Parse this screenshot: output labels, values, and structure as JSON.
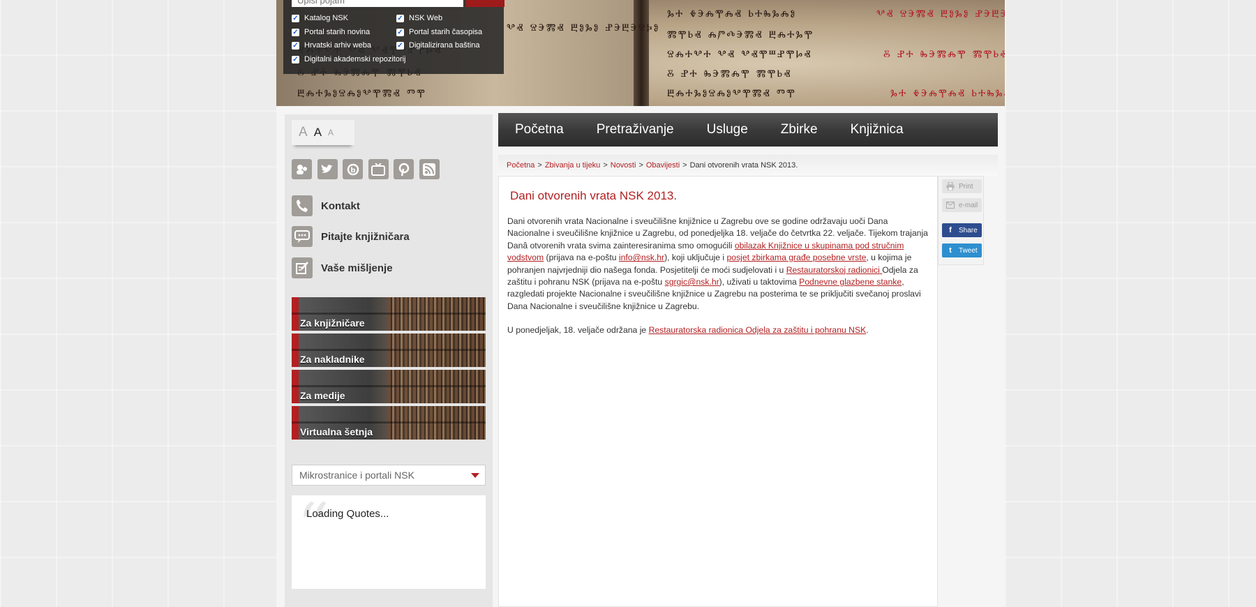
{
  "search": {
    "placeholder": "Upiši pojam",
    "sources": [
      {
        "label": "Katalog NSK",
        "checked": true
      },
      {
        "label": "NSK Web",
        "checked": true
      },
      {
        "label": "Portal starih novina",
        "checked": true
      },
      {
        "label": "Portal starih časopisa",
        "checked": true
      },
      {
        "label": "Hrvatski arhiv weba",
        "checked": true
      },
      {
        "label": "Digitalizirana baština",
        "checked": true
      },
      {
        "label": "Digitalni akademski repozitorij",
        "checked": true
      }
    ]
  },
  "font_sizer": {
    "large": "A",
    "medium": "A",
    "small": "A"
  },
  "social_icons": [
    "community-icon",
    "twitter-icon",
    "blog-icon",
    "tv-icon",
    "pinterest-icon",
    "rss-icon"
  ],
  "contact": {
    "items": [
      {
        "label": "Kontakt",
        "icon": "phone-icon"
      },
      {
        "label": "Pitajte knjižničara",
        "icon": "chat-icon"
      },
      {
        "label": "Vaše mišljenje",
        "icon": "feedback-icon"
      }
    ]
  },
  "tiles": [
    {
      "label": "Za knjižničare"
    },
    {
      "label": "Za nakladnike"
    },
    {
      "label": "Za medije"
    },
    {
      "label": "Virtualna šetnja"
    }
  ],
  "microsite_select": {
    "value": "Mikrostranice i portali NSK"
  },
  "quotes": {
    "text": "Loading Quotes..."
  },
  "nav": {
    "items": [
      "Početna",
      "Pretraživanje",
      "Usluge",
      "Zbirke",
      "Knjižnica"
    ]
  },
  "breadcrumb": {
    "links": [
      "Početna",
      "Zbivanja u tijeku",
      "Novosti",
      "Obavijesti"
    ],
    "current": "Dani otvorenih vrata NSK 2013."
  },
  "article": {
    "title": "Dani otvorenih vrata NSK 2013.",
    "p1": {
      "t1": "Dani otvorenih vrata Nacionalne i sveučilišne knjižnice u Zagrebu ove se godine održavaju uoči Dana Nacionalne i sveučilišne knjižnice u Zagrebu, od ponedjeljka 18. veljače do četvrtka 22. veljače. Tijekom trajanja Danâ otvorenih vrata svima zainteresiranima smo omogućili ",
      "l1": "obilazak Knjižnice u skupinama pod stručnim vodstvom",
      "t2": " (prijava na e-poštu ",
      "l2": "info@nsk.hr",
      "t3": "), koji uključuje i ",
      "l3": "posjet zbirkama građe posebne vrste",
      "t4": ", u kojima je pohranjen najvrjedniji dio našega fonda. Posjetitelji će moći sudjelovati i u ",
      "l4": "Restauratorskoj radionici ",
      "t5": "Odjela za zaštitu i pohranu NSK (prijava na e-poštu ",
      "l5": "sgrgic@nsk.hr",
      "t6": "), uživati u taktovima ",
      "l6": "Podnevne glazbene stanke",
      "t7": ", razgledati projekte Nacionalne i sveučilišne knjižnice u Zagrebu na posterima te se priključiti svečanoj proslavi Dana Nacionalne i sveučilišne knjižnice u Zagrebu."
    },
    "p2": {
      "t1": "U ponedjeljak, 18. veljače održana je ",
      "l1": "Restauratorska radionica Odjela za zaštitu i pohranu NSK",
      "t2": "."
    }
  },
  "tools": {
    "print": "Print",
    "email": "e-mail",
    "share": "Share",
    "tweet": "Tweet"
  },
  "banner_text": {
    "row1": "ⰳⰰ ⰷⰵⰾⰹⰾⱏ ⱃⰰⰸⰳⰾⱁ",
    "row2": "ⰲⱏ ⱄⰵⰿⱏ ⰱⱁⰳⱁ ⱀⰵⰱⰵⱄⰽⱁ",
    "row3": "ⰿⰹⱃⱏ ⰾⱓⰴⰵⰿⱏ ⰱⰾⰰⰳⰹ",
    "row4": "ⱄⰾⰰⰲⰰ ⰲⱏ ⰲⱏⰹⱎⱀⰹⱈⱏ",
    "row5": "ⰻ ⱀⰰ ⰸⰵⰿⰾⰹ ⰿⰹⱃⱏ",
    "row6": "ⰱⰾⰰⰳⱁⱄⰾⱁⰲⰹⰿⱏ ⱅⰹ"
  }
}
